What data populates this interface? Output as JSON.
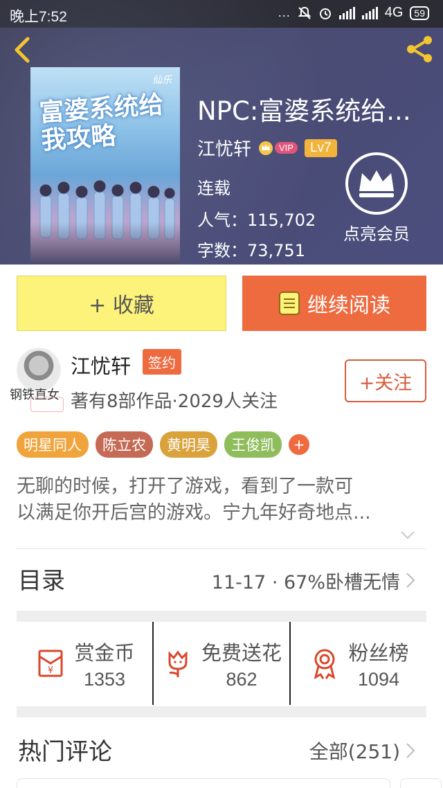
{
  "status_bar": {
    "time": "晚上7:52",
    "dots": "...",
    "network": "4G",
    "battery": "59"
  },
  "header": {
    "back_icon": "chevron-left-icon",
    "share_icon": "share-icon"
  },
  "book": {
    "cover_title": "富婆系统给我攻略",
    "cover_mark": "仙乐",
    "title": "NPC:富婆系统给...",
    "author": "江忧轩",
    "vip_label": "VIP",
    "level": "Lv7",
    "status": "连载",
    "popularity": "人气：115,702",
    "word_count": "字数：73,751",
    "member_label": "点亮会员"
  },
  "actions": {
    "collect_label": "+ 收藏",
    "read_label": "继续阅读"
  },
  "author_section": {
    "name": "江忧轩",
    "sign_badge": "签约",
    "stats": "著有8部作品·2029人关注",
    "follow_label": "+关注",
    "avatar_caption": "钢铁直女"
  },
  "tags": [
    {
      "label": "明星同人",
      "color": "#f0a43b"
    },
    {
      "label": "陈立农",
      "color": "#c56a55"
    },
    {
      "label": "黄明昊",
      "color": "#d9a23b"
    },
    {
      "label": "王俊凯",
      "color": "#8fbd5c"
    }
  ],
  "tag_add": "+",
  "description": {
    "line1": "无聊的时候，打开了游戏，看到了一款可",
    "line2": "以满足你开后宫的游戏。宁九年好奇地点..."
  },
  "catalog": {
    "title": "目录",
    "latest": "11-17 · 67%卧槽无情"
  },
  "stats": [
    {
      "label": "赏金币",
      "value": "1353",
      "icon": "red-envelope-icon"
    },
    {
      "label": "免费送花",
      "value": "862",
      "icon": "flower-icon"
    },
    {
      "label": "粉丝榜",
      "value": "1094",
      "icon": "medal-icon"
    }
  ],
  "comments": {
    "title": "热门评论",
    "all": "全部(251)"
  },
  "colors": {
    "accent": "#ee6a3f",
    "collect_bg": "#fdf37a",
    "header_bg": "#474870"
  }
}
